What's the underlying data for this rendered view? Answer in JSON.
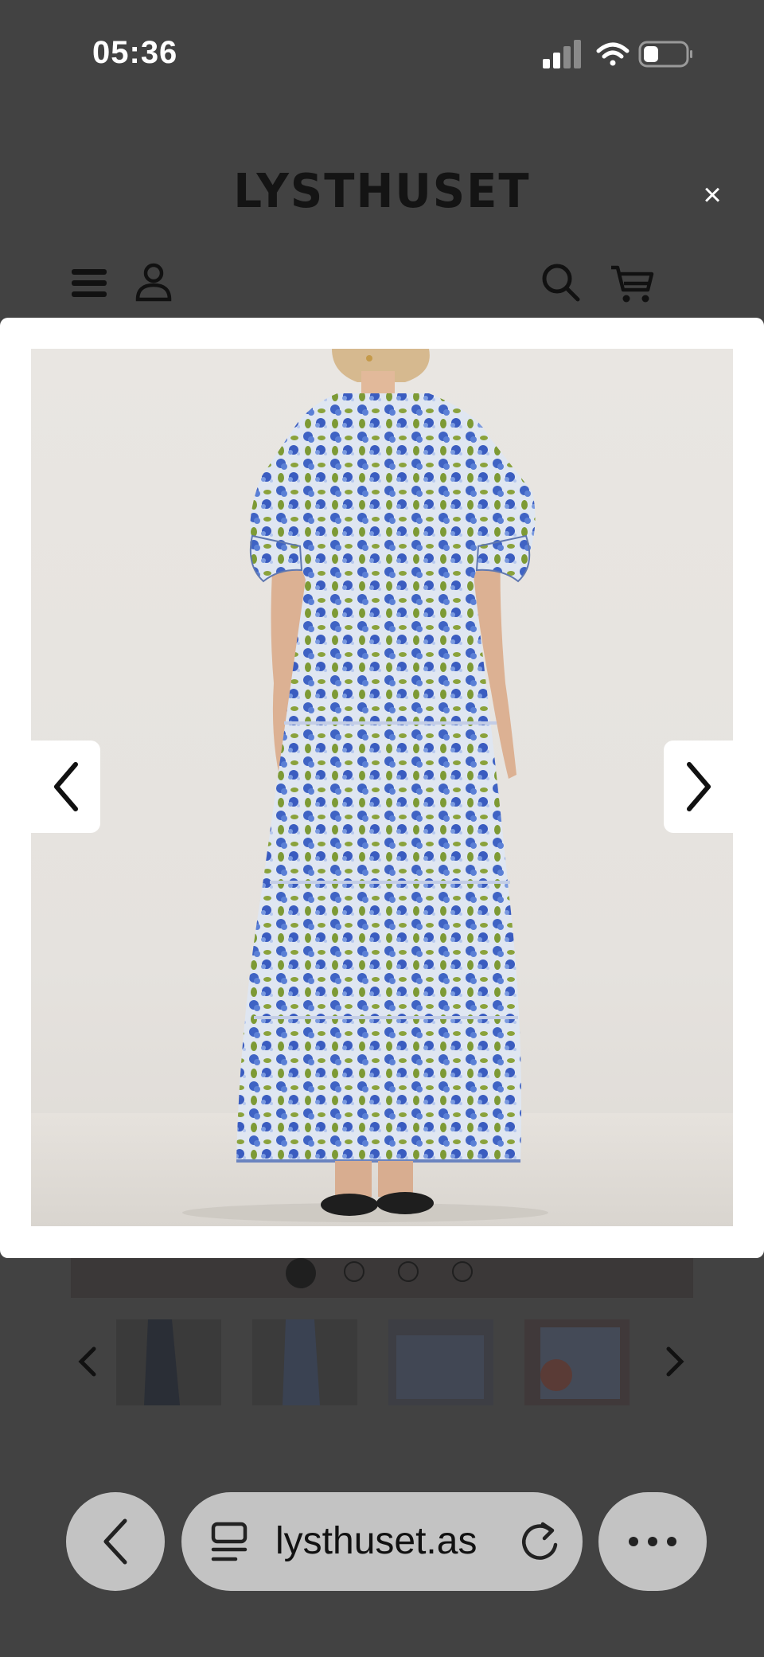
{
  "status_bar": {
    "time": "05:36",
    "icons": [
      "signal-icon",
      "wifi-icon",
      "battery-icon"
    ]
  },
  "header": {
    "logo": "LYSTHUSET",
    "close_label": "×",
    "icons": [
      "menu-icon",
      "account-icon",
      "search-icon",
      "cart-icon"
    ]
  },
  "lightbox": {
    "image_alt": "",
    "prev_icon": "chevron-left-icon",
    "next_icon": "chevron-right-icon"
  },
  "carousel": {
    "dots": 4,
    "active_dot": 0,
    "thumbnails": 4,
    "prev_icon": "chevron-left-icon",
    "next_icon": "chevron-right-icon"
  },
  "browser_bar": {
    "url": "lysthuset.as",
    "icons": [
      "back-icon",
      "page-icon",
      "reload-icon",
      "more-icon"
    ]
  },
  "colors": {
    "page_dim": "#424242",
    "pill": "#c3c3c3",
    "dress_blue": "#3f63c4",
    "dress_green": "#8aa23b"
  }
}
